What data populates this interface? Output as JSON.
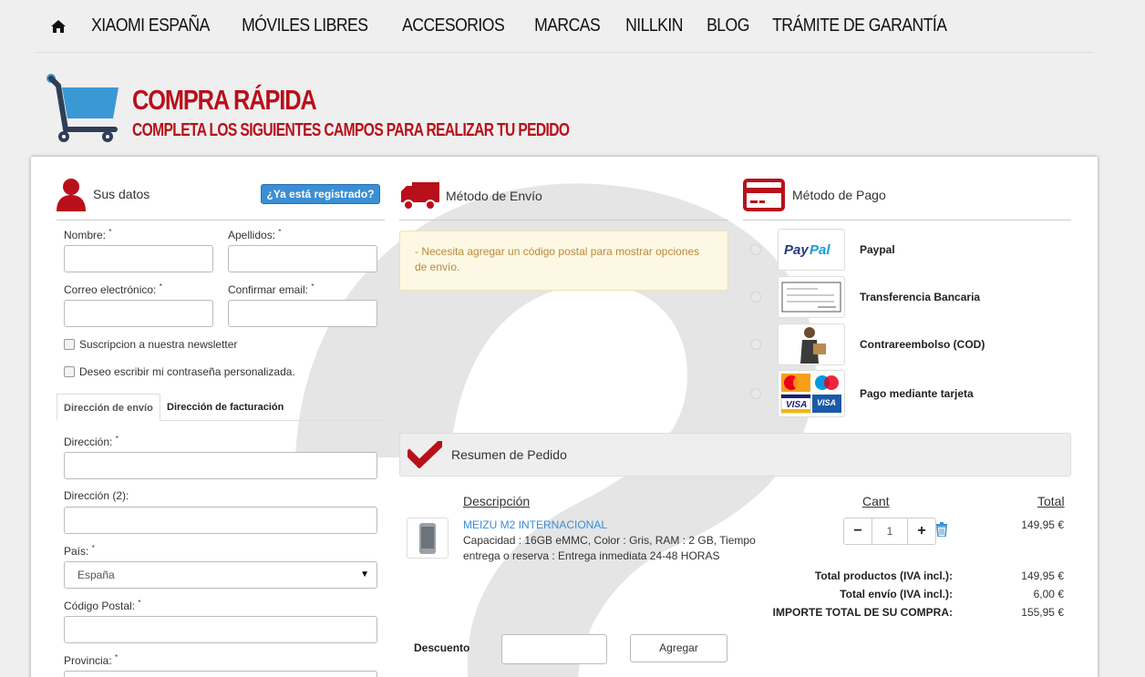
{
  "nav": {
    "items": [
      "XIAOMI ESPAÑA",
      "MÓVILES LIBRES",
      "ACCESORIOS",
      "MARCAS",
      "NILLKIN",
      "BLOG",
      "TRÁMITE DE GARANTÍA"
    ]
  },
  "header": {
    "title": "COMPRA RÁPIDA",
    "subtitle": "COMPLETA LOS SIGUIENTES CAMPOS PARA REALIZAR TU PEDIDO"
  },
  "colors": {
    "brand": "#b8101a",
    "accent": "#3a8fd6"
  },
  "datos": {
    "heading": "Sus datos",
    "registered_button": "¿Ya está registrado?",
    "nombre": "Nombre:",
    "apellidos": "Apellidos:",
    "correo": "Correo electrónico:",
    "confirmar": "Confirmar email:",
    "required_mark": "*",
    "newsletter": "Suscripcion a nuestra newsletter",
    "password": "Deseo escribir mi contraseña personalizada."
  },
  "tabs": {
    "envio": "Dirección de envío",
    "facturacion": "Dirección de facturación"
  },
  "direccion": {
    "direccion": "Dirección:",
    "direccion2": "Dirección (2):",
    "pais": "País:",
    "pais_value": "España",
    "cp": "Código Postal:",
    "provincia": "Provincia:"
  },
  "envio": {
    "heading": "Método de Envío",
    "alert": "- Necesita agregar un código postal para mostrar opciones de envío."
  },
  "pago": {
    "heading": "Método de Pago",
    "options": [
      "Paypal",
      "Transferencia Bancaria",
      "Contrareembolso (COD)",
      "Pago mediante tarjeta"
    ]
  },
  "resumen": {
    "heading": "Resumen de Pedido",
    "col_desc": "Descripción",
    "col_cant": "Cant",
    "col_total": "Total",
    "product_name": "MEIZU M2 INTERNACIONAL",
    "product_desc": "Capacidad : 16GB eMMC, Color : Gris, RAM : 2 GB, Tiempo entrega o reserva : Entrega inmediata 24-48 HORAS",
    "qty": "1",
    "line_total": "149,95 €",
    "total_productos_label": "Total productos (IVA incl.):",
    "total_productos": "149,95 €",
    "total_envio_label": "Total envío (IVA incl.):",
    "total_envio": "6,00 €",
    "importe_label": "IMPORTE TOTAL DE SU COMPRA:",
    "importe": "155,95 €",
    "descuento_label": "Descuento",
    "agregar": "Agregar"
  }
}
